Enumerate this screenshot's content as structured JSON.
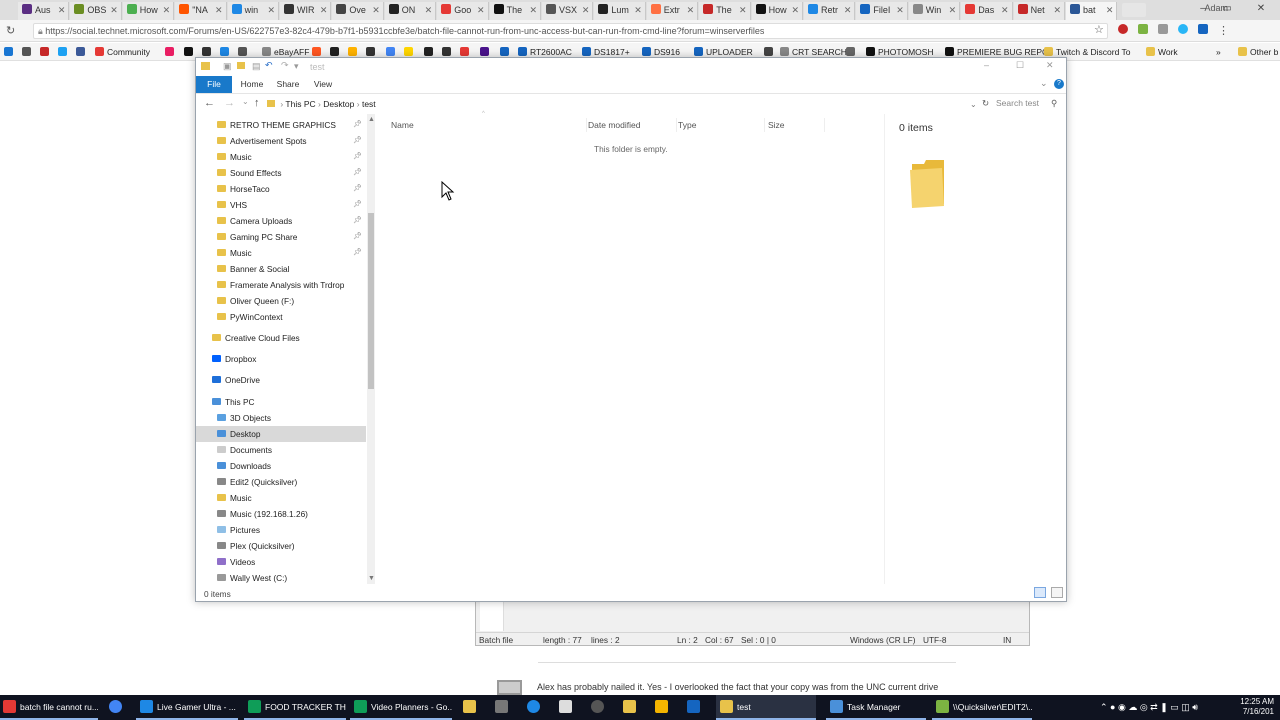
{
  "browser": {
    "tabs": [
      {
        "label": "Aus",
        "color": "#5a2d82"
      },
      {
        "label": "OBS",
        "color": "#6b8e23"
      },
      {
        "label": "How",
        "color": "#4caf50"
      },
      {
        "label": "\"NA",
        "color": "#ff5500"
      },
      {
        "label": "win",
        "color": "#1e88e5"
      },
      {
        "label": "WIR",
        "color": "#333333"
      },
      {
        "label": "Ove",
        "color": "#444444"
      },
      {
        "label": "ON",
        "color": "#222222"
      },
      {
        "label": "Goo",
        "color": "#e53935"
      },
      {
        "label": "The",
        "color": "#111111"
      },
      {
        "label": "VSX",
        "color": "#555555"
      },
      {
        "label": "Lum",
        "color": "#222222"
      },
      {
        "label": "Extr",
        "color": "#ff7043"
      },
      {
        "label": "The",
        "color": "#c62828"
      },
      {
        "label": "How",
        "color": "#111111"
      },
      {
        "label": "Retr",
        "color": "#1e88e5"
      },
      {
        "label": "FileI",
        "color": "#1565c0"
      },
      {
        "label": "Win",
        "color": "#888888"
      },
      {
        "label": "Das",
        "color": "#e53935"
      },
      {
        "label": "Net",
        "color": "#c62828"
      },
      {
        "label": "bat",
        "color": "#2b5797"
      }
    ],
    "user": "Adam",
    "url": "https://social.technet.microsoft.com/Forums/en-US/622757e3-82c4-479b-b7f1-b5931ccbfe3e/batch-file-cannot-run-from-unc-access-but-can-run-from-cmd-line?forum=winserverfiles",
    "bookmarks": [
      "Community",
      "eBayAFF",
      "RT2600AC",
      "DS1817+",
      "DS916",
      "UPLOADER",
      "CRT SEARCH",
      "PHOTOMOSH",
      "PREMIERE BUG REPO",
      "Twitch & Discord To",
      "Work",
      "Other b"
    ]
  },
  "explorer": {
    "title": "test",
    "ribbon_tabs": [
      "File",
      "Home",
      "Share",
      "View"
    ],
    "path": [
      "This PC",
      "Desktop",
      "test"
    ],
    "search_placeholder": "Search test",
    "nav_items": [
      {
        "label": "RETRO THEME GRAPHICS",
        "pinned": true
      },
      {
        "label": "Advertisement Spots",
        "pinned": true
      },
      {
        "label": "Music",
        "pinned": true
      },
      {
        "label": "Sound Effects",
        "pinned": true
      },
      {
        "label": "HorseTaco",
        "pinned": true
      },
      {
        "label": "VHS",
        "pinned": true
      },
      {
        "label": "Camera Uploads",
        "pinned": true
      },
      {
        "label": "Gaming PC Share",
        "pinned": true
      },
      {
        "label": "Music",
        "pinned": true
      },
      {
        "label": "Banner & Social",
        "pinned": false
      },
      {
        "label": "Framerate Analysis with Trdrop",
        "pinned": false
      },
      {
        "label": "Oliver Queen (F:)",
        "pinned": false
      },
      {
        "label": "PyWinContext",
        "pinned": false
      },
      {
        "label": "Creative Cloud Files",
        "pinned": false
      },
      {
        "label": "Dropbox",
        "pinned": false
      },
      {
        "label": "OneDrive",
        "pinned": false
      },
      {
        "label": "This PC",
        "pinned": false
      },
      {
        "label": "3D Objects",
        "pinned": false
      },
      {
        "label": "Desktop",
        "pinned": false
      },
      {
        "label": "Documents",
        "pinned": false
      },
      {
        "label": "Downloads",
        "pinned": false
      },
      {
        "label": "Edit2 (Quicksilver)",
        "pinned": false
      },
      {
        "label": "Music",
        "pinned": false
      },
      {
        "label": "Music (192.168.1.26)",
        "pinned": false
      },
      {
        "label": "Pictures",
        "pinned": false
      },
      {
        "label": "Plex (Quicksilver)",
        "pinned": false
      },
      {
        "label": "Videos",
        "pinned": false
      },
      {
        "label": "Wally West (C:)",
        "pinned": false
      }
    ],
    "columns": [
      "Name",
      "Date modified",
      "Type",
      "Size"
    ],
    "empty_message": "This folder is empty.",
    "details_count": "0 items",
    "status": "0 items"
  },
  "notepad": {
    "filetype": "Batch file",
    "length": "length : 77",
    "lines": "lines : 2",
    "ln": "Ln : 2",
    "col": "Col : 67",
    "sel": "Sel : 0 | 0",
    "eol": "Windows (CR LF)",
    "enc": "UTF-8",
    "mode": "IN"
  },
  "page": {
    "comment": "Alex has probably nailed it.  Yes - I overlooked the fact that your copy was from the UNC current drive"
  },
  "taskbar": {
    "items": [
      {
        "label": "batch file cannot ru...",
        "color": "#e53935"
      },
      {
        "label": "",
        "color": "#4285f4"
      },
      {
        "label": "Live Gamer Ultra - ...",
        "color": "#1e88e5"
      },
      {
        "label": "FOOD TRACKER THI...",
        "color": "#0f9d58"
      },
      {
        "label": "Video Planners - Go...",
        "color": "#0f9d58"
      },
      {
        "label": "test",
        "color": "#e8c24a"
      },
      {
        "label": "Task Manager",
        "color": "#4a90d9"
      },
      {
        "label": "\\\\Quicksilver\\EDIT2\\...",
        "color": "#7cb342"
      }
    ],
    "time": "12:25 AM",
    "date": "7/16/201"
  }
}
